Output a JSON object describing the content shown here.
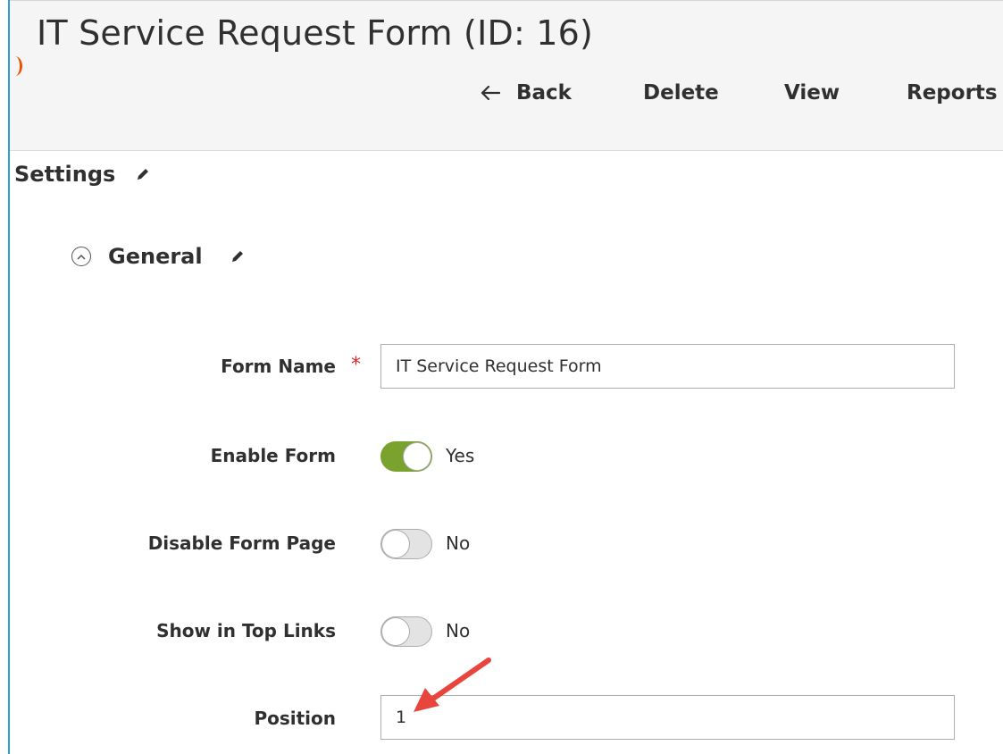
{
  "header": {
    "title": "IT Service Request Form (ID: 16)",
    "actions": {
      "back": "Back",
      "delete": "Delete",
      "view": "View",
      "reports": "Reports"
    }
  },
  "settings": {
    "title": "Settings",
    "group": {
      "title": "General",
      "fields": {
        "form_name": {
          "label": "Form Name",
          "required_mark": "*",
          "value": "IT Service Request Form"
        },
        "enable_form": {
          "label": "Enable Form",
          "state": "Yes"
        },
        "disable_form_page": {
          "label": "Disable Form Page",
          "state": "No"
        },
        "show_in_top_links": {
          "label": "Show in Top Links",
          "state": "No"
        },
        "position": {
          "label": "Position",
          "value": "1"
        }
      }
    }
  },
  "colors": {
    "accent_blue": "#2f9ed2",
    "toggle_on": "#79a22e",
    "required_red": "#e22626",
    "annotation_arrow": "#e8453c"
  },
  "icons": [
    "back-arrow-icon",
    "pencil-icon",
    "collapse-chevron-icon",
    "annotation-arrow"
  ]
}
